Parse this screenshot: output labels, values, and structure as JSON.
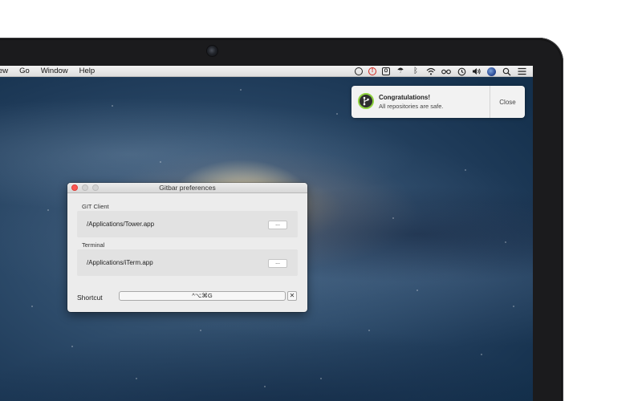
{
  "menubar": {
    "items": [
      "ew",
      "Go",
      "Window",
      "Help"
    ],
    "status_icons": [
      "sync-icon",
      "record-icon",
      "app-icon",
      "umbrella-icon",
      "bluetooth-icon",
      "wifi-icon",
      "glasses-icon",
      "time-machine-icon",
      "volume-icon",
      "globe-icon",
      "search-icon",
      "list-icon"
    ]
  },
  "notification": {
    "title": "Congratulations!",
    "body": "All repositories are safe.",
    "close_label": "Close",
    "accent": "#8fd33f"
  },
  "prefs": {
    "title": "Gitbar preferences",
    "git_client_label": "GIT Client",
    "git_client_path": "/Applications/Tower.app",
    "terminal_label": "Terminal",
    "terminal_path": "/Applications/iTerm.app",
    "browse_label": "...",
    "shortcut_label": "Shortcut",
    "shortcut_value": "^⌥⌘G",
    "clear_label": "✕"
  }
}
